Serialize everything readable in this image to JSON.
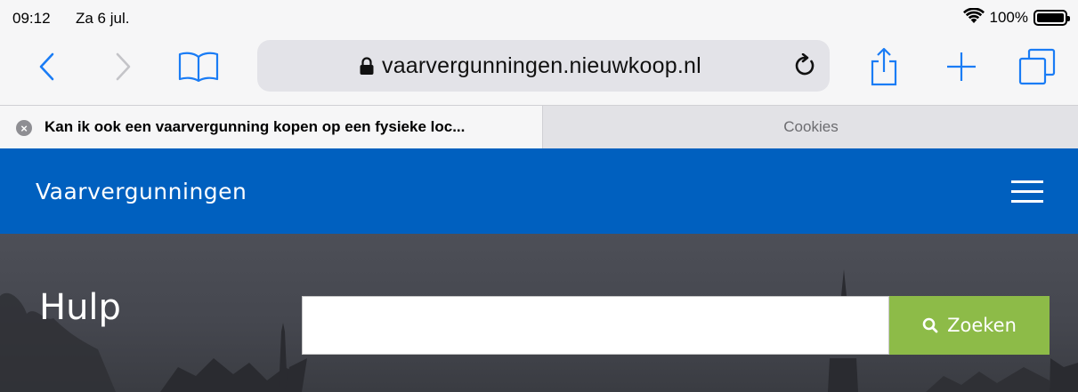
{
  "status": {
    "time": "09:12",
    "date": "Za 6 jul.",
    "battery": "100%"
  },
  "toolbar": {
    "url": "vaarvergunningen.nieuwkoop.nl"
  },
  "tabs": [
    {
      "title": "Kan ik ook een vaarvergunning kopen op een fysieke loc...",
      "active": true
    },
    {
      "title": "Cookies",
      "active": false
    }
  ],
  "site": {
    "title": "Vaarvergunningen"
  },
  "hero": {
    "heading": "Hulp",
    "search_value": "",
    "search_button": "Zoeken"
  },
  "colors": {
    "brand_blue": "#0060bf",
    "search_green": "#8dbb48",
    "ios_blue": "#1a7cf5"
  }
}
